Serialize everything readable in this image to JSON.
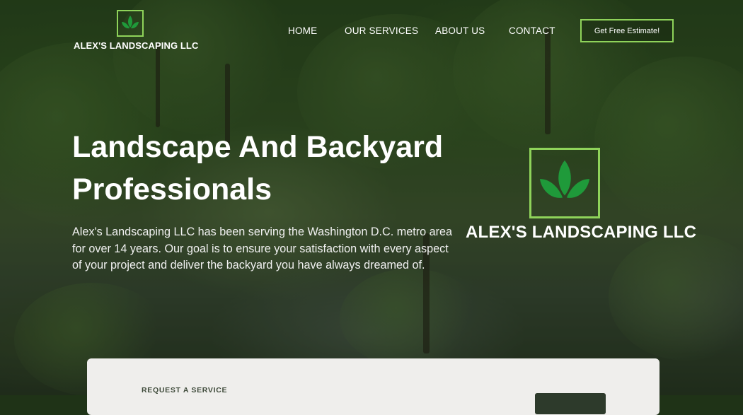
{
  "header": {
    "brand_name": "ALEX'S LANDSCAPING LLC",
    "nav": [
      {
        "label": "HOME"
      },
      {
        "label": "OUR SERVICES"
      },
      {
        "label": "ABOUT US"
      },
      {
        "label": "CONTACT"
      }
    ],
    "cta_label": "Get Free Estimate!"
  },
  "hero": {
    "title_line1": "Landscape And Backyard",
    "title_line2": "Professionals",
    "description": "Alex's Landscaping LLC has been serving the Washington D.C. metro area for over 14 years. Our goal is to ensure your satisfaction with every aspect of your project and deliver the backyard you have always dreamed of.",
    "logo_name": "ALEX'S LANDSCAPING LLC"
  },
  "service_card": {
    "eyebrow": "REQUEST A SERVICE"
  },
  "icons": {
    "brand_logo": "leaf-icon",
    "hero_logo": "leaf-icon"
  },
  "colors": {
    "accent": "#8fd35a",
    "leaf": "#1f9a3a",
    "card_bg": "#efeeec",
    "eyebrow_text": "#3e4a3a"
  }
}
